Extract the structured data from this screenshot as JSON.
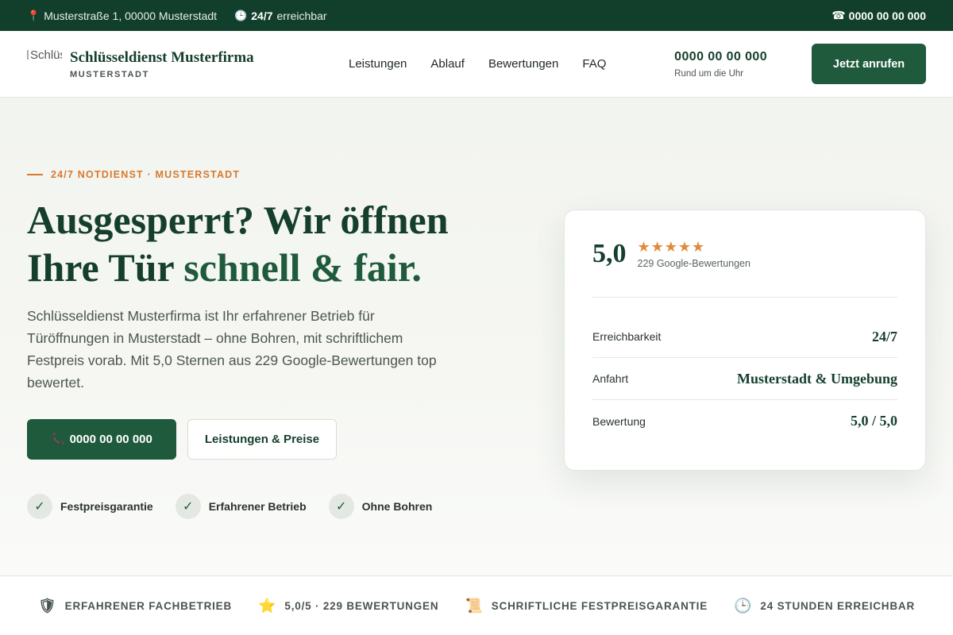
{
  "topbar": {
    "address": "Musterstraße 1, 00000 Musterstadt",
    "availability_strong": "24/7",
    "availability_text": "erreichbar",
    "phone": "0000 00 00 000"
  },
  "header": {
    "logo_alt": "Schlüs",
    "brand_name": "Schlüsseldienst Musterfirma",
    "brand_city": "MUSTERSTADT",
    "nav": [
      "Leistungen",
      "Ablauf",
      "Bewertungen",
      "FAQ"
    ],
    "phone": "0000 00 00 000",
    "phone_sub": "Rund um die Uhr",
    "cta": "Jetzt anrufen"
  },
  "hero": {
    "eyebrow": "24/7 NOTDIENST · MUSTERSTADT",
    "headline_line1": "Ausgesperrt? Wir öffnen",
    "headline_line2_plain": "Ihre Tür ",
    "headline_line2_accent": "schnell & fair.",
    "lead": "Schlüsseldienst Musterfirma ist Ihr erfahrener Betrieb für Türöffnungen in Musterstadt – ohne Bohren, mit schriftlichem Festpreis vorab. Mit 5,0 Sternen aus 229 Google-Bewertungen top bewertet.",
    "primary_cta": "0000 00 00 000",
    "secondary_cta": "Leistungen & Preise",
    "features": [
      "Festpreisgarantie",
      "Erfahrener Betrieb",
      "Ohne Bohren"
    ]
  },
  "card": {
    "score": "5,0",
    "stars": "★★★★★",
    "count": "229 Google-Bewertungen",
    "rows": [
      {
        "key": "Erreichbarkeit",
        "value": "24/7"
      },
      {
        "key": "Anfahrt",
        "value": "Musterstadt & Umgebung"
      },
      {
        "key": "Bewertung",
        "value": "5,0 / 5,0"
      }
    ]
  },
  "trust": [
    {
      "icon": "shield-icon",
      "glyph": "🛡",
      "label": "ERFAHRENER FACHBETRIEB"
    },
    {
      "icon": "star-icon",
      "glyph": "⭐",
      "label": "5,0/5 · 229 BEWERTUNGEN"
    },
    {
      "icon": "scroll-icon",
      "glyph": "📜",
      "label": "SCHRIFTLICHE FESTPREISGARANTIE"
    },
    {
      "icon": "clock-icon",
      "glyph": "🕒",
      "label": "24 STUNDEN ERREICHBAR"
    }
  ],
  "colors": {
    "brand_dark": "#123f2b",
    "brand_green": "#1f5a3c",
    "accent_orange": "#d87a2e"
  }
}
